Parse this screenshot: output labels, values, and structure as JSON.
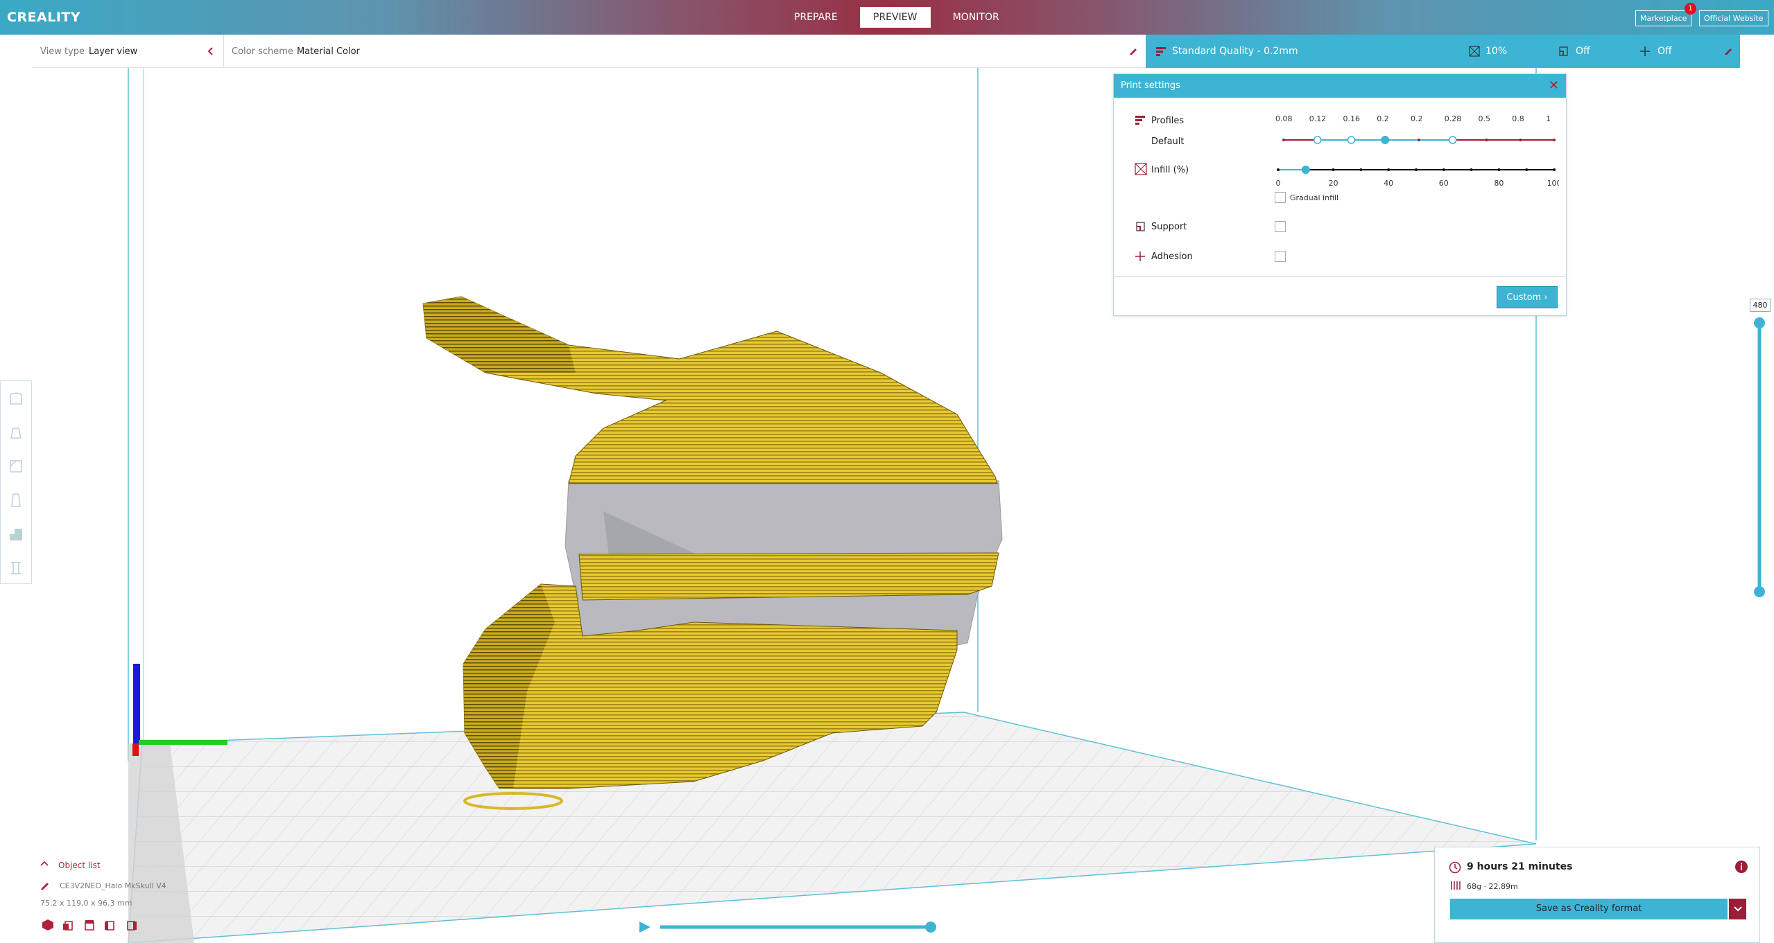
{
  "app": {
    "logo": "CREALITY"
  },
  "header": {
    "tabs": [
      {
        "label": "PREPARE"
      },
      {
        "label": "PREVIEW"
      },
      {
        "label": "MONITOR"
      }
    ],
    "marketplace_label": "Marketplace",
    "marketplace_badge": "1",
    "website_label": "Official Website"
  },
  "toolbar": {
    "view_type_label": "View type",
    "view_type_value": "Layer view",
    "color_scheme_label": "Color scheme",
    "color_scheme_value": "Material Color"
  },
  "quality_bar": {
    "profile": "Standard Quality - 0.2mm",
    "infill": "10%",
    "support": "Off",
    "adhesion": "Off"
  },
  "print_settings": {
    "title": "Print settings",
    "profiles_label": "Profiles",
    "profile_name": "Default",
    "profile_ticks": [
      "0.08",
      "0.12",
      "0.16",
      "0.2",
      "0.2",
      "0.28",
      "0.5",
      "0.8",
      "1"
    ],
    "profile_selected_index": 3,
    "infill_label": "Infill (%)",
    "infill_ticks": [
      "0",
      "20",
      "40",
      "60",
      "80",
      "100"
    ],
    "infill_value": 10,
    "gradual_infill_label": "Gradual infill",
    "support_label": "Support",
    "adhesion_label": "Adhesion",
    "custom_label": "Custom"
  },
  "layer_slider": {
    "value": "480"
  },
  "object_list": {
    "label": "Object list",
    "object_name": "CE3V2NEO_Halo MkSkull V4",
    "dimensions": "75.2 x 119.0 x 96.3 mm"
  },
  "print_info": {
    "time": "9 hours 21 minutes",
    "material": "68g · 22.89m",
    "save_label": "Save as Creality format"
  },
  "colors": {
    "accent": "#3db4d3",
    "brand_red": "#9a1f36",
    "model_yellow": "#e5c531"
  }
}
